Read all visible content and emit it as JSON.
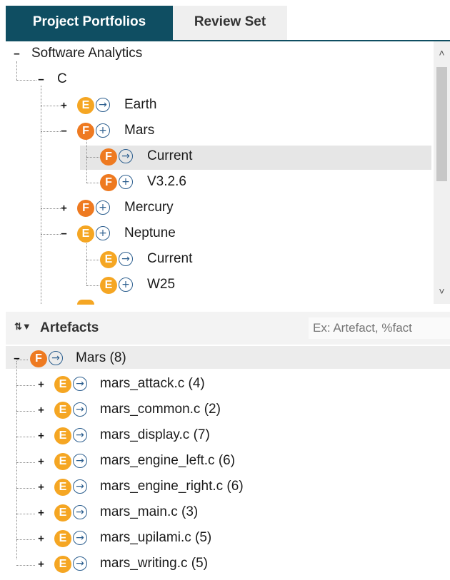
{
  "tabs": {
    "active": "Project Portfolios",
    "inactive": "Review Set"
  },
  "tree": {
    "root": "Software Analytics",
    "group": "C",
    "projects": [
      {
        "expander": "+",
        "badge": "E",
        "trend": "→",
        "label": "Earth"
      },
      {
        "expander": "−",
        "badge": "F",
        "trend": "+",
        "label": "Mars"
      },
      {
        "expander": "",
        "badge": "F",
        "trend": "→",
        "label": "Current",
        "selected": true
      },
      {
        "expander": "",
        "badge": "F",
        "trend": "+",
        "label": "V3.2.6"
      },
      {
        "expander": "+",
        "badge": "F",
        "trend": "+",
        "label": "Mercury"
      },
      {
        "expander": "−",
        "badge": "E",
        "trend": "+",
        "label": "Neptune"
      },
      {
        "expander": "",
        "badge": "E",
        "trend": "→",
        "label": "Current"
      },
      {
        "expander": "",
        "badge": "E",
        "trend": "+",
        "label": "W25"
      }
    ]
  },
  "artefacts": {
    "title": "Artefacts",
    "search_placeholder": "Ex: Artefact, %fact",
    "root": {
      "badge": "F",
      "trend": "→",
      "label": "Mars (8)"
    },
    "items": [
      {
        "badge": "E",
        "trend": "→",
        "label": "mars_attack.c (4)"
      },
      {
        "badge": "E",
        "trend": "→",
        "label": "mars_common.c (2)"
      },
      {
        "badge": "E",
        "trend": "→",
        "label": "mars_display.c (7)"
      },
      {
        "badge": "E",
        "trend": "→",
        "label": "mars_engine_left.c (6)"
      },
      {
        "badge": "E",
        "trend": "→",
        "label": "mars_engine_right.c (6)"
      },
      {
        "badge": "E",
        "trend": "→",
        "label": "mars_main.c (3)"
      },
      {
        "badge": "E",
        "trend": "→",
        "label": "mars_upilami.c (5)"
      },
      {
        "badge": "E",
        "trend": "→",
        "label": "mars_writing.c (5)"
      }
    ]
  },
  "colors": {
    "tab_active": "#0f4e62",
    "badge_F": "#ee7a21",
    "badge_E": "#f5a623",
    "trend": "#2d5f8f"
  }
}
